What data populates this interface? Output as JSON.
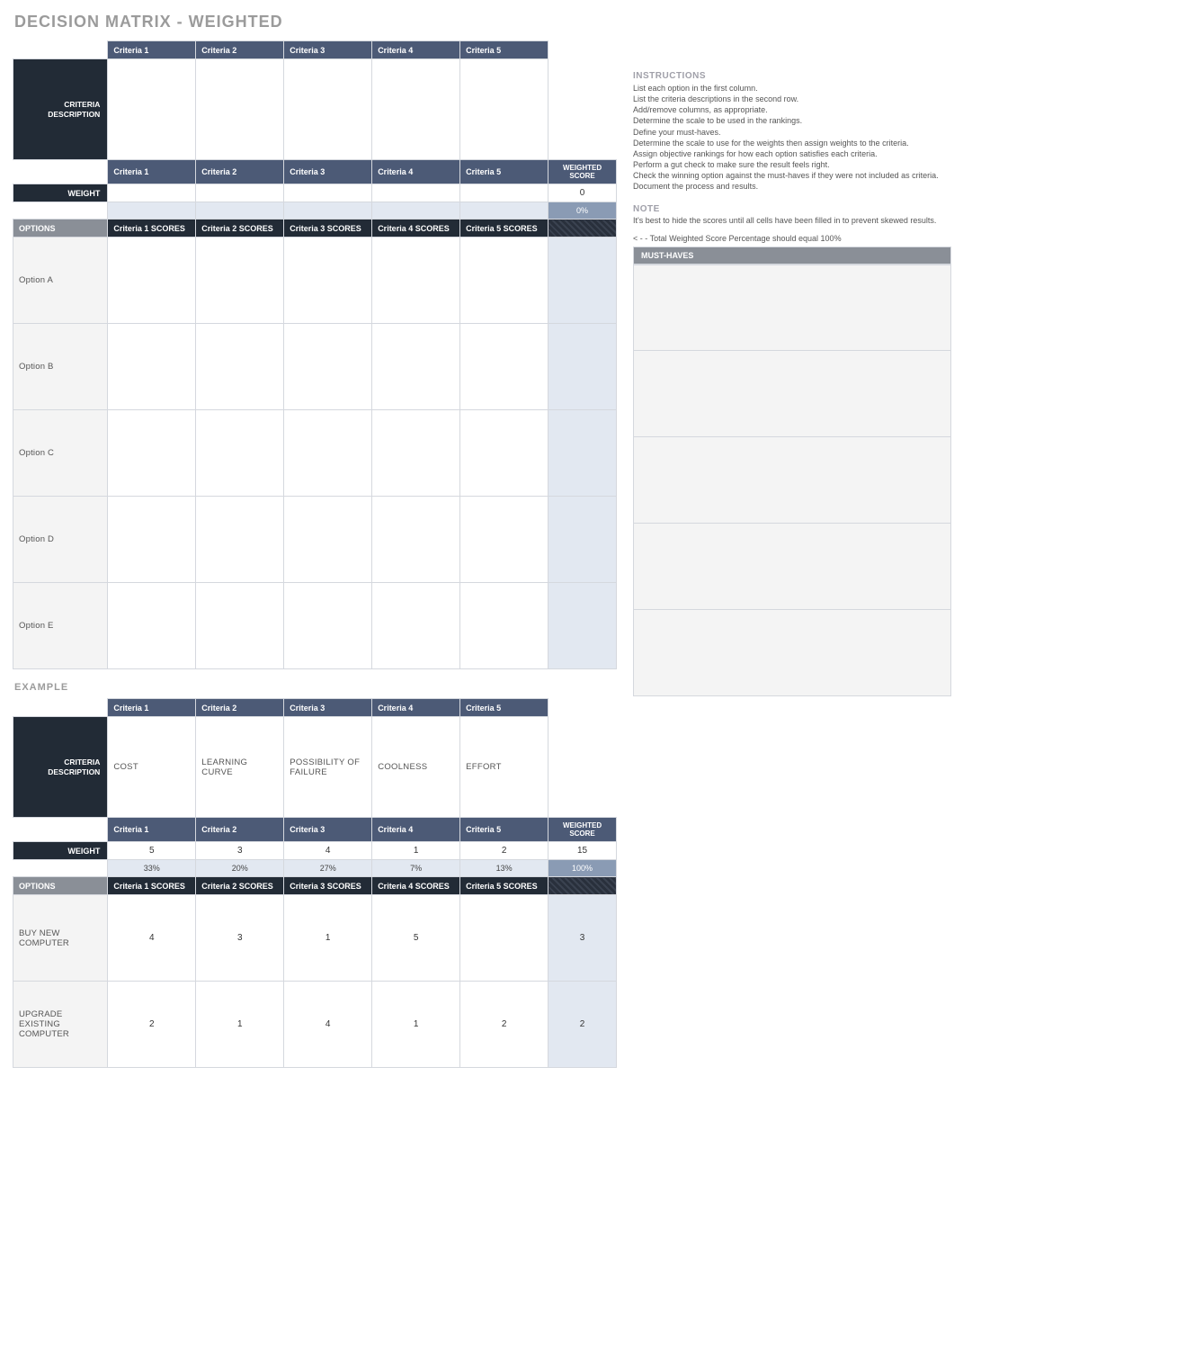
{
  "title": "DECISION MATRIX - WEIGHTED",
  "criteria_labels": [
    "Criteria 1",
    "Criteria 2",
    "Criteria 3",
    "Criteria 4",
    "Criteria 5"
  ],
  "criteria_scores_labels": [
    "Criteria 1 SCORES",
    "Criteria 2 SCORES",
    "Criteria 3 SCORES",
    "Criteria 4 SCORES",
    "Criteria 5 SCORES"
  ],
  "row_labels": {
    "criteria_description": "CRITERIA\nDESCRIPTION",
    "weight": "WEIGHT",
    "options": "OPTIONS",
    "weighted_score": "WEIGHTED SCORE"
  },
  "main": {
    "descriptions": [
      "",
      "",
      "",
      "",
      ""
    ],
    "weights": [
      "",
      "",
      "",
      "",
      ""
    ],
    "weighted_score_total": "0",
    "pct": [
      "",
      "",
      "",
      "",
      ""
    ],
    "pct_total": "0%",
    "options": [
      {
        "name": "Option A",
        "scores": [
          "",
          "",
          "",
          "",
          ""
        ],
        "ws": ""
      },
      {
        "name": "Option B",
        "scores": [
          "",
          "",
          "",
          "",
          ""
        ],
        "ws": ""
      },
      {
        "name": "Option C",
        "scores": [
          "",
          "",
          "",
          "",
          ""
        ],
        "ws": ""
      },
      {
        "name": "Option D",
        "scores": [
          "",
          "",
          "",
          "",
          ""
        ],
        "ws": ""
      },
      {
        "name": "Option E",
        "scores": [
          "",
          "",
          "",
          "",
          ""
        ],
        "ws": ""
      }
    ]
  },
  "example_title": "EXAMPLE",
  "example": {
    "descriptions": [
      "COST",
      "LEARNING CURVE",
      "POSSIBILITY OF FAILURE",
      "COOLNESS",
      "EFFORT"
    ],
    "weights": [
      "5",
      "3",
      "4",
      "1",
      "2"
    ],
    "weighted_score_total": "15",
    "pct": [
      "33%",
      "20%",
      "27%",
      "7%",
      "13%"
    ],
    "pct_total": "100%",
    "options": [
      {
        "name": "BUY NEW COMPUTER",
        "scores": [
          "4",
          "3",
          "1",
          "5",
          "",
          "3"
        ],
        "cells": [
          "4",
          "3",
          "1",
          "5",
          ""
        ],
        "ws": "3"
      },
      {
        "name": "UPGRADE EXISTING COMPUTER",
        "cells": [
          "2",
          "1",
          "4",
          "1",
          "2"
        ],
        "ws": "2"
      }
    ]
  },
  "instructions": {
    "heading": "INSTRUCTIONS",
    "lines": [
      "List each option in the first column.",
      "List the criteria descriptions in the second row.",
      "Add/remove columns, as appropriate.",
      "Determine the scale to be used in the rankings.",
      "Define your must-haves.",
      "Determine the scale to use for the weights then assign weights to the criteria.",
      "Assign objective rankings for how each option satisfies each criteria.",
      "Perform a gut check to make sure the result feels right.",
      "Check the winning option against the must-haves if they were not included as criteria.",
      "Document the process and results."
    ]
  },
  "note": {
    "heading": "NOTE",
    "body": "It's best to hide the scores until all cells have been filled in to prevent skewed results."
  },
  "hint": "< - - Total Weighted Score Percentage should equal 100%",
  "must_haves_label": "MUST-HAVES"
}
